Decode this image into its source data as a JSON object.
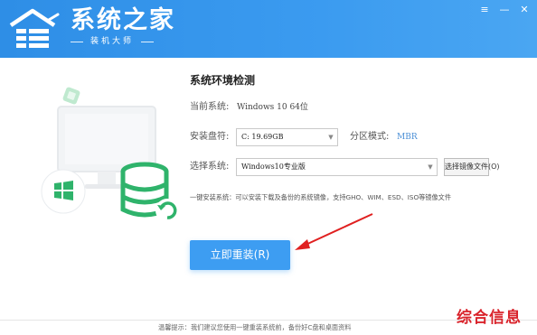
{
  "brand": {
    "title": "系统之家",
    "subtitle": "装机大师"
  },
  "window_controls": {
    "menu": "≡",
    "minimize": "—",
    "close": "✕"
  },
  "panel": {
    "title": "系统环境检测",
    "current_system_label": "当前系统:",
    "current_system_value": "Windows 10 64位",
    "install_drive_label": "安装盘符:",
    "install_drive_value": "C: 19.69GB",
    "partition_mode_label": "分区模式:",
    "partition_mode_value": "MBR",
    "select_system_label": "选择系统:",
    "select_system_value": "Windows10专业版",
    "browse_button": "选择镜像文件(O)",
    "info_text": "一键安装系统：可以安装下载及备份的系统镜像，支持GHO、WIM、ESD、ISO等镜像文件"
  },
  "install_button": "立即重装(R)",
  "footer": {
    "tip": "温馨提示：我们建议您使用一键重装系统前，备份好C盘和桌面资料"
  },
  "watermark": "综合信息",
  "colors": {
    "titlebar": "#3b9bf0",
    "accent": "#3d9df2",
    "illustration_green": "#2fb36b",
    "annotation_red": "#e02020",
    "watermark_red": "#d9232b"
  },
  "icons": {
    "logo": "house-logo-icon",
    "windows": "windows-logo-icon",
    "database": "database-icon",
    "refresh": "refresh-icon",
    "chevron": "chevron-down-icon"
  }
}
